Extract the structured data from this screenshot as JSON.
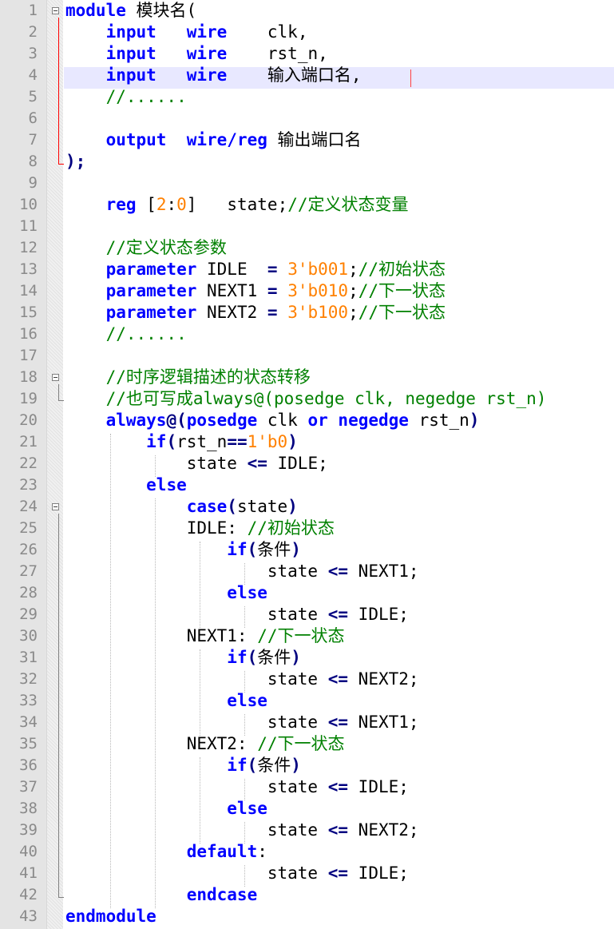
{
  "editor": {
    "language": "verilog",
    "current_line": 4,
    "colors": {
      "keyword": "#0000ff",
      "comment": "#008000",
      "number": "#ff8000",
      "operator": "#000080",
      "text": "#000000",
      "gutter_bg": "#e4e4e4",
      "current_line_bg": "#e8e8ff",
      "line_number": "#8a8a8a"
    },
    "fold_markers": [
      1,
      18,
      24
    ],
    "lines": [
      {
        "num": "1",
        "tokens": [
          {
            "t": "module",
            "c": "kw"
          },
          {
            "t": " 模块名(",
            "c": "tx"
          }
        ]
      },
      {
        "num": "2",
        "tokens": [
          {
            "t": "    ",
            "c": "tx"
          },
          {
            "t": "input",
            "c": "kw"
          },
          {
            "t": "   ",
            "c": "tx"
          },
          {
            "t": "wire",
            "c": "kw"
          },
          {
            "t": "    clk,",
            "c": "tx"
          }
        ]
      },
      {
        "num": "3",
        "tokens": [
          {
            "t": "    ",
            "c": "tx"
          },
          {
            "t": "input",
            "c": "kw"
          },
          {
            "t": "   ",
            "c": "tx"
          },
          {
            "t": "wire",
            "c": "kw"
          },
          {
            "t": "    rst_n,",
            "c": "tx"
          }
        ]
      },
      {
        "num": "4",
        "tokens": [
          {
            "t": "    ",
            "c": "tx"
          },
          {
            "t": "input",
            "c": "kw"
          },
          {
            "t": "   ",
            "c": "tx"
          },
          {
            "t": "wire",
            "c": "kw"
          },
          {
            "t": "    输入端口名,",
            "c": "tx"
          }
        ]
      },
      {
        "num": "5",
        "tokens": [
          {
            "t": "    ",
            "c": "tx"
          },
          {
            "t": "//......",
            "c": "cm"
          }
        ]
      },
      {
        "num": "6",
        "tokens": []
      },
      {
        "num": "7",
        "tokens": [
          {
            "t": "    ",
            "c": "tx"
          },
          {
            "t": "output",
            "c": "kw"
          },
          {
            "t": "  ",
            "c": "tx"
          },
          {
            "t": "wire/reg",
            "c": "kw"
          },
          {
            "t": " 输出端口名",
            "c": "tx"
          }
        ]
      },
      {
        "num": "8",
        "tokens": [
          {
            "t": ");",
            "c": "op"
          }
        ]
      },
      {
        "num": "9",
        "tokens": []
      },
      {
        "num": "10",
        "tokens": [
          {
            "t": "    ",
            "c": "tx"
          },
          {
            "t": "reg",
            "c": "kw"
          },
          {
            "t": " [",
            "c": "tx"
          },
          {
            "t": "2",
            "c": "nm"
          },
          {
            "t": ":",
            "c": "tx"
          },
          {
            "t": "0",
            "c": "nm"
          },
          {
            "t": "]   state;",
            "c": "tx"
          },
          {
            "t": "//定义状态变量",
            "c": "cm"
          }
        ]
      },
      {
        "num": "11",
        "tokens": []
      },
      {
        "num": "12",
        "tokens": [
          {
            "t": "    ",
            "c": "tx"
          },
          {
            "t": "//定义状态参数",
            "c": "cm"
          }
        ]
      },
      {
        "num": "13",
        "tokens": [
          {
            "t": "    ",
            "c": "tx"
          },
          {
            "t": "parameter",
            "c": "kw"
          },
          {
            "t": " IDLE  ",
            "c": "tx"
          },
          {
            "t": "=",
            "c": "op"
          },
          {
            "t": " ",
            "c": "tx"
          },
          {
            "t": "3'b001",
            "c": "nm"
          },
          {
            "t": ";",
            "c": "tx"
          },
          {
            "t": "//初始状态",
            "c": "cm"
          }
        ]
      },
      {
        "num": "14",
        "tokens": [
          {
            "t": "    ",
            "c": "tx"
          },
          {
            "t": "parameter",
            "c": "kw"
          },
          {
            "t": " NEXT1 ",
            "c": "tx"
          },
          {
            "t": "=",
            "c": "op"
          },
          {
            "t": " ",
            "c": "tx"
          },
          {
            "t": "3'b010",
            "c": "nm"
          },
          {
            "t": ";",
            "c": "tx"
          },
          {
            "t": "//下一状态",
            "c": "cm"
          }
        ]
      },
      {
        "num": "15",
        "tokens": [
          {
            "t": "    ",
            "c": "tx"
          },
          {
            "t": "parameter",
            "c": "kw"
          },
          {
            "t": " NEXT2 ",
            "c": "tx"
          },
          {
            "t": "=",
            "c": "op"
          },
          {
            "t": " ",
            "c": "tx"
          },
          {
            "t": "3'b100",
            "c": "nm"
          },
          {
            "t": ";",
            "c": "tx"
          },
          {
            "t": "//下一状态",
            "c": "cm"
          }
        ]
      },
      {
        "num": "16",
        "tokens": [
          {
            "t": "    ",
            "c": "tx"
          },
          {
            "t": "//......",
            "c": "cm"
          }
        ]
      },
      {
        "num": "17",
        "tokens": []
      },
      {
        "num": "18",
        "tokens": [
          {
            "t": "    ",
            "c": "tx"
          },
          {
            "t": "//时序逻辑描述的状态转移",
            "c": "cm"
          }
        ]
      },
      {
        "num": "19",
        "tokens": [
          {
            "t": "    ",
            "c": "tx"
          },
          {
            "t": "//也可写成always@(posedge clk, negedge rst_n)",
            "c": "cm"
          }
        ]
      },
      {
        "num": "20",
        "tokens": [
          {
            "t": "    ",
            "c": "tx"
          },
          {
            "t": "always",
            "c": "kw"
          },
          {
            "t": "@(",
            "c": "op"
          },
          {
            "t": "posedge",
            "c": "kw"
          },
          {
            "t": " clk ",
            "c": "tx"
          },
          {
            "t": "or",
            "c": "kw"
          },
          {
            "t": " ",
            "c": "tx"
          },
          {
            "t": "negedge",
            "c": "kw"
          },
          {
            "t": " rst_n",
            "c": "tx"
          },
          {
            "t": ")",
            "c": "op"
          }
        ]
      },
      {
        "num": "21",
        "tokens": [
          {
            "t": "        ",
            "c": "tx"
          },
          {
            "t": "if",
            "c": "kw"
          },
          {
            "t": "(",
            "c": "op"
          },
          {
            "t": "rst_n",
            "c": "tx"
          },
          {
            "t": "==",
            "c": "op"
          },
          {
            "t": "1'b0",
            "c": "nm"
          },
          {
            "t": ")",
            "c": "op"
          }
        ]
      },
      {
        "num": "22",
        "tokens": [
          {
            "t": "            state ",
            "c": "tx"
          },
          {
            "t": "<=",
            "c": "op"
          },
          {
            "t": " IDLE;",
            "c": "tx"
          }
        ]
      },
      {
        "num": "23",
        "tokens": [
          {
            "t": "        ",
            "c": "tx"
          },
          {
            "t": "else",
            "c": "kw"
          }
        ]
      },
      {
        "num": "24",
        "tokens": [
          {
            "t": "            ",
            "c": "tx"
          },
          {
            "t": "case",
            "c": "kw"
          },
          {
            "t": "(",
            "c": "op"
          },
          {
            "t": "state",
            "c": "tx"
          },
          {
            "t": ")",
            "c": "op"
          }
        ]
      },
      {
        "num": "25",
        "tokens": [
          {
            "t": "            IDLE: ",
            "c": "tx"
          },
          {
            "t": "//初始状态",
            "c": "cm"
          }
        ]
      },
      {
        "num": "26",
        "tokens": [
          {
            "t": "                ",
            "c": "tx"
          },
          {
            "t": "if",
            "c": "kw"
          },
          {
            "t": "(",
            "c": "op"
          },
          {
            "t": "条件",
            "c": "tx"
          },
          {
            "t": ")",
            "c": "op"
          }
        ]
      },
      {
        "num": "27",
        "tokens": [
          {
            "t": "                    state ",
            "c": "tx"
          },
          {
            "t": "<=",
            "c": "op"
          },
          {
            "t": " NEXT1;",
            "c": "tx"
          }
        ]
      },
      {
        "num": "28",
        "tokens": [
          {
            "t": "                ",
            "c": "tx"
          },
          {
            "t": "else",
            "c": "kw"
          }
        ]
      },
      {
        "num": "29",
        "tokens": [
          {
            "t": "                    state ",
            "c": "tx"
          },
          {
            "t": "<=",
            "c": "op"
          },
          {
            "t": " IDLE;",
            "c": "tx"
          }
        ]
      },
      {
        "num": "30",
        "tokens": [
          {
            "t": "            NEXT1: ",
            "c": "tx"
          },
          {
            "t": "//下一状态",
            "c": "cm"
          }
        ]
      },
      {
        "num": "31",
        "tokens": [
          {
            "t": "                ",
            "c": "tx"
          },
          {
            "t": "if",
            "c": "kw"
          },
          {
            "t": "(",
            "c": "op"
          },
          {
            "t": "条件",
            "c": "tx"
          },
          {
            "t": ")",
            "c": "op"
          }
        ]
      },
      {
        "num": "32",
        "tokens": [
          {
            "t": "                    state ",
            "c": "tx"
          },
          {
            "t": "<=",
            "c": "op"
          },
          {
            "t": " NEXT2;",
            "c": "tx"
          }
        ]
      },
      {
        "num": "33",
        "tokens": [
          {
            "t": "                ",
            "c": "tx"
          },
          {
            "t": "else",
            "c": "kw"
          }
        ]
      },
      {
        "num": "34",
        "tokens": [
          {
            "t": "                    state ",
            "c": "tx"
          },
          {
            "t": "<=",
            "c": "op"
          },
          {
            "t": " NEXT1;",
            "c": "tx"
          }
        ]
      },
      {
        "num": "35",
        "tokens": [
          {
            "t": "            NEXT2: ",
            "c": "tx"
          },
          {
            "t": "//下一状态",
            "c": "cm"
          }
        ]
      },
      {
        "num": "36",
        "tokens": [
          {
            "t": "                ",
            "c": "tx"
          },
          {
            "t": "if",
            "c": "kw"
          },
          {
            "t": "(",
            "c": "op"
          },
          {
            "t": "条件",
            "c": "tx"
          },
          {
            "t": ")",
            "c": "op"
          }
        ]
      },
      {
        "num": "37",
        "tokens": [
          {
            "t": "                    state ",
            "c": "tx"
          },
          {
            "t": "<=",
            "c": "op"
          },
          {
            "t": " IDLE;",
            "c": "tx"
          }
        ]
      },
      {
        "num": "38",
        "tokens": [
          {
            "t": "                ",
            "c": "tx"
          },
          {
            "t": "else",
            "c": "kw"
          }
        ]
      },
      {
        "num": "39",
        "tokens": [
          {
            "t": "                    state ",
            "c": "tx"
          },
          {
            "t": "<=",
            "c": "op"
          },
          {
            "t": " NEXT2;",
            "c": "tx"
          }
        ]
      },
      {
        "num": "40",
        "tokens": [
          {
            "t": "            ",
            "c": "tx"
          },
          {
            "t": "default",
            "c": "kw"
          },
          {
            "t": ":",
            "c": "tx"
          }
        ]
      },
      {
        "num": "41",
        "tokens": [
          {
            "t": "                    state ",
            "c": "tx"
          },
          {
            "t": "<=",
            "c": "op"
          },
          {
            "t": " IDLE;",
            "c": "tx"
          }
        ]
      },
      {
        "num": "42",
        "tokens": [
          {
            "t": "            ",
            "c": "tx"
          },
          {
            "t": "endcase",
            "c": "kw"
          }
        ]
      },
      {
        "num": "43",
        "tokens": [
          {
            "t": "endmodule",
            "c": "kw"
          }
        ]
      }
    ]
  }
}
